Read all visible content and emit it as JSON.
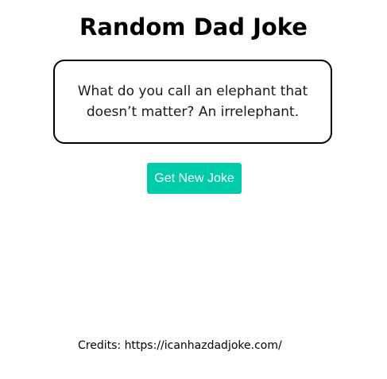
{
  "header": {
    "title": "Random Dad Joke"
  },
  "joke": {
    "text": "What do you call an elephant that doesn’t matter? An irrelephant."
  },
  "actions": {
    "get_joke_label": "Get New Joke"
  },
  "footer": {
    "credits": "Credits: https://icanhazdadjoke.com/"
  },
  "colors": {
    "accent": "#00ccaa",
    "card_border": "#000000"
  }
}
